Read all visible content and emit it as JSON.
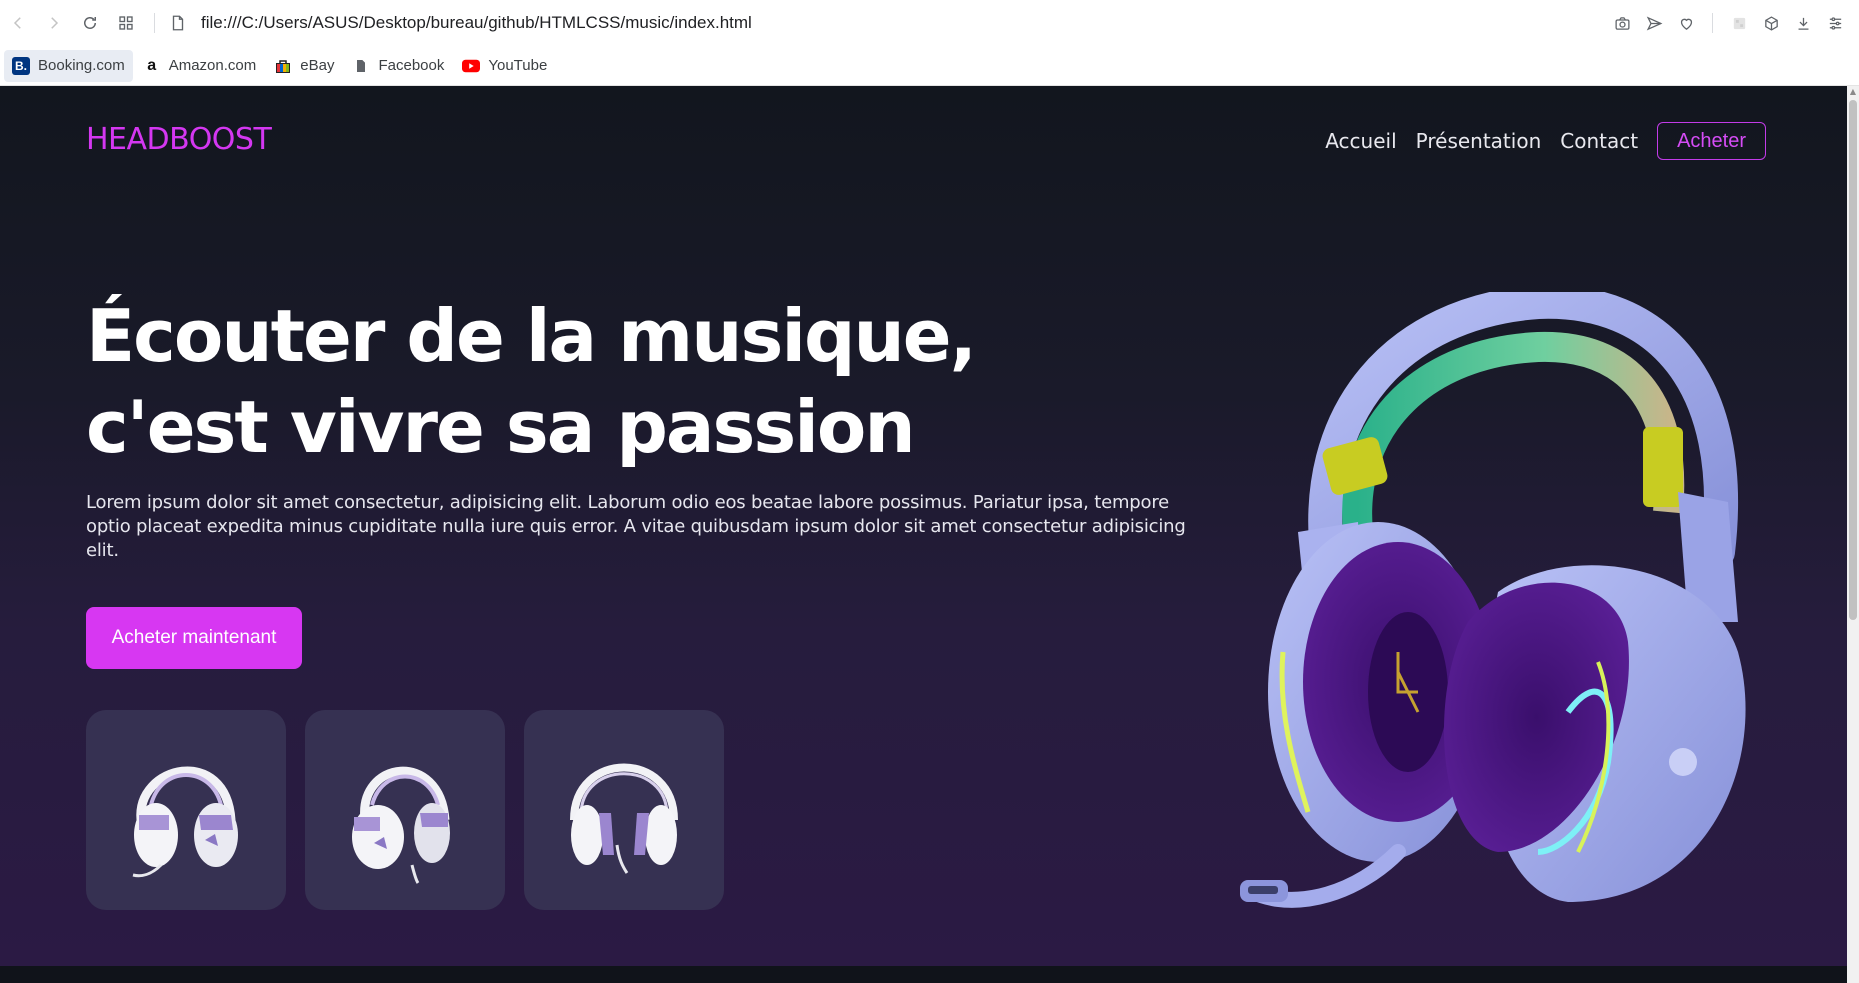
{
  "browser": {
    "url": "file:///C:/Users/ASUS/Desktop/bureau/github/HTMLCSS/music/index.html",
    "bookmarks": [
      {
        "label": "Booking.com",
        "icon": "booking-icon",
        "color": "#003580"
      },
      {
        "label": "Amazon.com",
        "icon": "amazon-icon",
        "color": "#ff9900"
      },
      {
        "label": "eBay",
        "icon": "ebay-icon",
        "color": "#e53238"
      },
      {
        "label": "Facebook",
        "icon": "document-icon",
        "color": "#5f6368"
      },
      {
        "label": "YouTube",
        "icon": "youtube-icon",
        "color": "#ff0000"
      }
    ]
  },
  "site": {
    "logo": "HEADBOOST",
    "nav": [
      "Accueil",
      "Présentation",
      "Contact"
    ],
    "buy_label": "Acheter",
    "title_line1": "Écouter de la musique,",
    "title_line2": "c'est vivre sa passion",
    "paragraph": "Lorem ipsum dolor sit amet consectetur, adipisicing elit. Laborum odio eos beatae labore possimus. Pariatur ipsa, tempore optio placeat expedita minus cupiditate nulla iure quis error. A vitae quibusdam ipsum dolor sit amet consectetur adipisicing elit.",
    "cta_label": "Acheter maintenant",
    "colors": {
      "accent": "#d737f2",
      "thumb_bg": "#363152",
      "headset_body": "#9ea7e8",
      "ear_cushion": "#4b1a86"
    }
  }
}
